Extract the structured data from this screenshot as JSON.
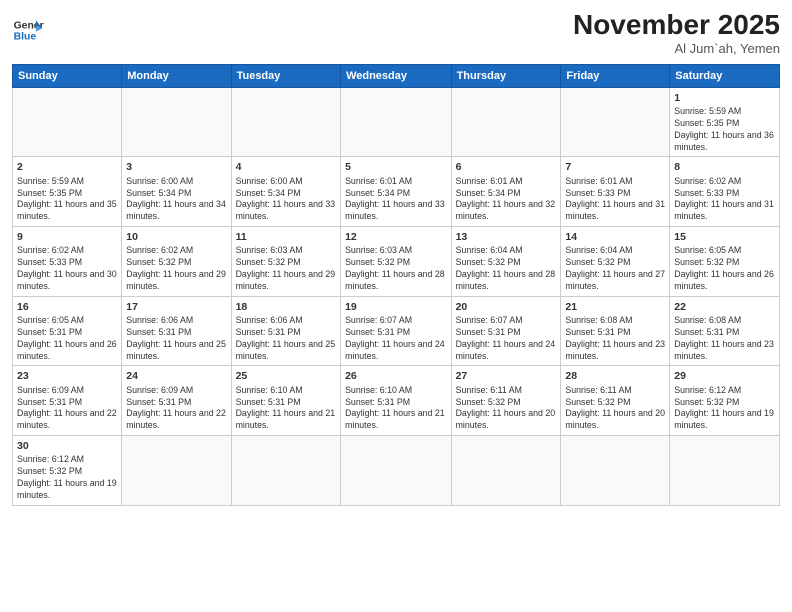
{
  "header": {
    "logo_line1": "General",
    "logo_line2": "Blue",
    "month": "November 2025",
    "location": "Al Jum`ah, Yemen"
  },
  "weekdays": [
    "Sunday",
    "Monday",
    "Tuesday",
    "Wednesday",
    "Thursday",
    "Friday",
    "Saturday"
  ],
  "weeks": [
    [
      {
        "day": "",
        "info": ""
      },
      {
        "day": "",
        "info": ""
      },
      {
        "day": "",
        "info": ""
      },
      {
        "day": "",
        "info": ""
      },
      {
        "day": "",
        "info": ""
      },
      {
        "day": "",
        "info": ""
      },
      {
        "day": "1",
        "info": "Sunrise: 5:59 AM\nSunset: 5:35 PM\nDaylight: 11 hours and 36 minutes."
      }
    ],
    [
      {
        "day": "2",
        "info": "Sunrise: 5:59 AM\nSunset: 5:35 PM\nDaylight: 11 hours and 35 minutes."
      },
      {
        "day": "3",
        "info": "Sunrise: 6:00 AM\nSunset: 5:34 PM\nDaylight: 11 hours and 34 minutes."
      },
      {
        "day": "4",
        "info": "Sunrise: 6:00 AM\nSunset: 5:34 PM\nDaylight: 11 hours and 33 minutes."
      },
      {
        "day": "5",
        "info": "Sunrise: 6:01 AM\nSunset: 5:34 PM\nDaylight: 11 hours and 33 minutes."
      },
      {
        "day": "6",
        "info": "Sunrise: 6:01 AM\nSunset: 5:34 PM\nDaylight: 11 hours and 32 minutes."
      },
      {
        "day": "7",
        "info": "Sunrise: 6:01 AM\nSunset: 5:33 PM\nDaylight: 11 hours and 31 minutes."
      },
      {
        "day": "8",
        "info": "Sunrise: 6:02 AM\nSunset: 5:33 PM\nDaylight: 11 hours and 31 minutes."
      }
    ],
    [
      {
        "day": "9",
        "info": "Sunrise: 6:02 AM\nSunset: 5:33 PM\nDaylight: 11 hours and 30 minutes."
      },
      {
        "day": "10",
        "info": "Sunrise: 6:02 AM\nSunset: 5:32 PM\nDaylight: 11 hours and 29 minutes."
      },
      {
        "day": "11",
        "info": "Sunrise: 6:03 AM\nSunset: 5:32 PM\nDaylight: 11 hours and 29 minutes."
      },
      {
        "day": "12",
        "info": "Sunrise: 6:03 AM\nSunset: 5:32 PM\nDaylight: 11 hours and 28 minutes."
      },
      {
        "day": "13",
        "info": "Sunrise: 6:04 AM\nSunset: 5:32 PM\nDaylight: 11 hours and 28 minutes."
      },
      {
        "day": "14",
        "info": "Sunrise: 6:04 AM\nSunset: 5:32 PM\nDaylight: 11 hours and 27 minutes."
      },
      {
        "day": "15",
        "info": "Sunrise: 6:05 AM\nSunset: 5:32 PM\nDaylight: 11 hours and 26 minutes."
      }
    ],
    [
      {
        "day": "16",
        "info": "Sunrise: 6:05 AM\nSunset: 5:31 PM\nDaylight: 11 hours and 26 minutes."
      },
      {
        "day": "17",
        "info": "Sunrise: 6:06 AM\nSunset: 5:31 PM\nDaylight: 11 hours and 25 minutes."
      },
      {
        "day": "18",
        "info": "Sunrise: 6:06 AM\nSunset: 5:31 PM\nDaylight: 11 hours and 25 minutes."
      },
      {
        "day": "19",
        "info": "Sunrise: 6:07 AM\nSunset: 5:31 PM\nDaylight: 11 hours and 24 minutes."
      },
      {
        "day": "20",
        "info": "Sunrise: 6:07 AM\nSunset: 5:31 PM\nDaylight: 11 hours and 24 minutes."
      },
      {
        "day": "21",
        "info": "Sunrise: 6:08 AM\nSunset: 5:31 PM\nDaylight: 11 hours and 23 minutes."
      },
      {
        "day": "22",
        "info": "Sunrise: 6:08 AM\nSunset: 5:31 PM\nDaylight: 11 hours and 23 minutes."
      }
    ],
    [
      {
        "day": "23",
        "info": "Sunrise: 6:09 AM\nSunset: 5:31 PM\nDaylight: 11 hours and 22 minutes."
      },
      {
        "day": "24",
        "info": "Sunrise: 6:09 AM\nSunset: 5:31 PM\nDaylight: 11 hours and 22 minutes."
      },
      {
        "day": "25",
        "info": "Sunrise: 6:10 AM\nSunset: 5:31 PM\nDaylight: 11 hours and 21 minutes."
      },
      {
        "day": "26",
        "info": "Sunrise: 6:10 AM\nSunset: 5:31 PM\nDaylight: 11 hours and 21 minutes."
      },
      {
        "day": "27",
        "info": "Sunrise: 6:11 AM\nSunset: 5:32 PM\nDaylight: 11 hours and 20 minutes."
      },
      {
        "day": "28",
        "info": "Sunrise: 6:11 AM\nSunset: 5:32 PM\nDaylight: 11 hours and 20 minutes."
      },
      {
        "day": "29",
        "info": "Sunrise: 6:12 AM\nSunset: 5:32 PM\nDaylight: 11 hours and 19 minutes."
      }
    ],
    [
      {
        "day": "30",
        "info": "Sunrise: 6:12 AM\nSunset: 5:32 PM\nDaylight: 11 hours and 19 minutes."
      },
      {
        "day": "",
        "info": ""
      },
      {
        "day": "",
        "info": ""
      },
      {
        "day": "",
        "info": ""
      },
      {
        "day": "",
        "info": ""
      },
      {
        "day": "",
        "info": ""
      },
      {
        "day": "",
        "info": ""
      }
    ]
  ]
}
